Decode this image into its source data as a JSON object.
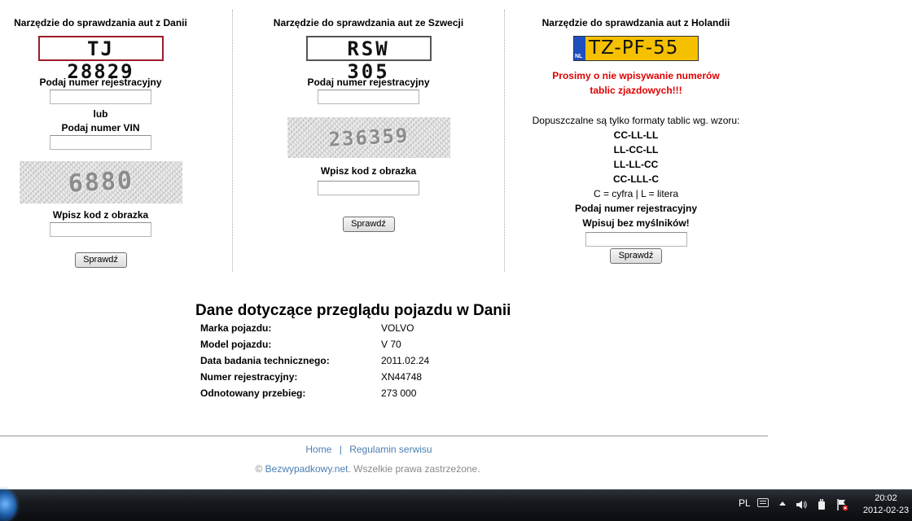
{
  "columns": {
    "denmark": {
      "title": "Narzędzie do sprawdzania aut z Danii",
      "plate": "TJ 28829",
      "reg_label": "Podaj numer rejestracyjny",
      "or_label": "lub",
      "vin_label": "Podaj numer VIN",
      "captcha_text": "6880",
      "captcha_label": "Wpisz kod z obrazka",
      "button": "Sprawdź"
    },
    "sweden": {
      "title": "Narzędzie do sprawdzania aut ze Szwecji",
      "plate": "RSW 305",
      "reg_label": "Podaj numer rejestracyjny",
      "captcha_text": "236359",
      "captcha_label": "Wpisz kod z obrazka",
      "button": "Sprawdź"
    },
    "netherlands": {
      "title": "Narzędzie do sprawdzania aut z Holandii",
      "plate": "TZ-PF-55",
      "plate_country": "NL",
      "warning_line1": "Prosimy o nie wpisywanie numerów",
      "warning_line2": "tablic zjazdowych!!!",
      "formats_intro": "Dopuszczalne są tylko formaty tablic wg. wzoru:",
      "formats": [
        "CC-LL-LL",
        "LL-CC-LL",
        "LL-LL-CC",
        "CC-LLL-C"
      ],
      "legend": "C = cyfra | L = litera",
      "reg_label": "Podaj numer rejestracyjny",
      "no_dash_label": "Wpisuj bez myślników!",
      "button": "Sprawdź"
    }
  },
  "result": {
    "heading": "Dane dotyczące przeglądu pojazdu w Danii",
    "rows": [
      {
        "label": "Marka pojazdu:",
        "value": "VOLVO"
      },
      {
        "label": "Model pojazdu:",
        "value": "V 70"
      },
      {
        "label": "Data badania technicznego:",
        "value": "2011.02.24"
      },
      {
        "label": "Numer rejestracyjny:",
        "value": "XN44748"
      },
      {
        "label": "Odnotowany przebieg:",
        "value": "273 000"
      }
    ]
  },
  "footer": {
    "link_home": "Home",
    "separator": "|",
    "link_terms": "Regulamin serwisu",
    "copyright_symbol": "©",
    "site_name": "Bezwypadkowy.net",
    "rights": ". Wszelkie prawa zastrzeżone."
  },
  "taskbar": {
    "language": "PL",
    "time": "20:02",
    "date": "2012-02-23"
  },
  "colors": {
    "danish_plate_border": "#9b1b2a",
    "dutch_plate_bg": "#f5c000",
    "dutch_plate_band": "#1f4fbf",
    "warning_red": "#e00000",
    "link_blue": "#4a7eb3"
  }
}
